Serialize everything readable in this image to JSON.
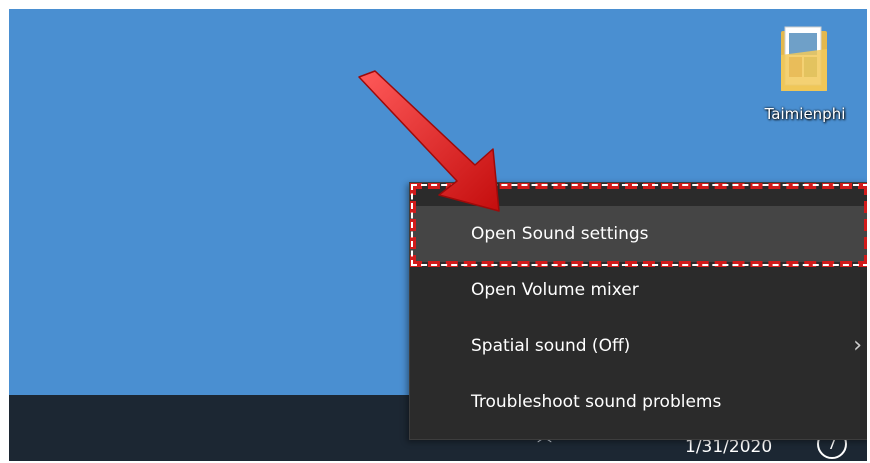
{
  "desktop": {
    "background_color": "#4a8fd1",
    "icon": {
      "label": "Taimienphi",
      "icon_name": "photo-folder-icon"
    }
  },
  "context_menu": {
    "items": [
      {
        "label": "Open Sound settings",
        "highlighted": true
      },
      {
        "label": "Open Volume mixer"
      },
      {
        "label": "Spatial sound (Off)",
        "submenu_indicator": "›"
      },
      {
        "label": "Troubleshoot sound problems"
      }
    ]
  },
  "taskbar": {
    "date": "1/31/2020",
    "notification_count": "7",
    "tray_icons": [
      "show-hidden-icons-icon",
      "network-icon"
    ]
  },
  "annotation": {
    "arrow_color": "#e01b1b",
    "highlight_box_color": "#d11b1b"
  }
}
